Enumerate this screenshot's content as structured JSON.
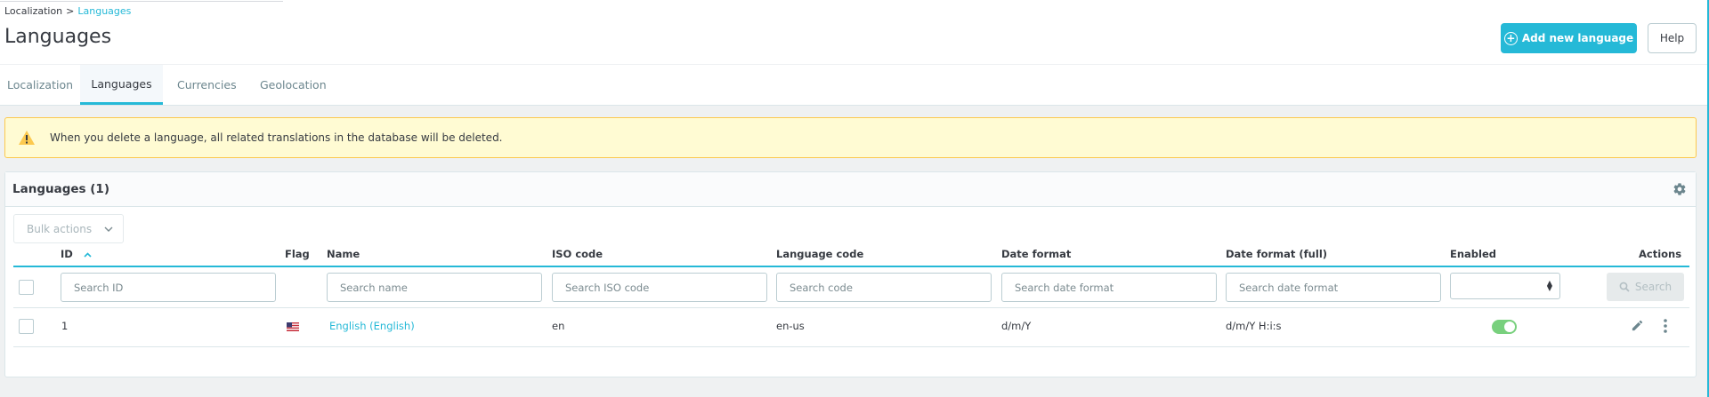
{
  "breadcrumb": {
    "parent": "Localization",
    "separator": ">",
    "current": "Languages"
  },
  "page_title": "Languages",
  "toolbar": {
    "add_label": "Add new language",
    "add_icon": "plus-circle-icon",
    "help_label": "Help"
  },
  "tabs": [
    {
      "label": "Localization",
      "active": false
    },
    {
      "label": "Languages",
      "active": true
    },
    {
      "label": "Currencies",
      "active": false
    },
    {
      "label": "Geolocation",
      "active": false
    }
  ],
  "alert": {
    "icon": "warning-icon",
    "message": "When you delete a language, all related translations in the database will be deleted."
  },
  "card": {
    "title": "Languages (1)",
    "settings_icon": "gear-icon",
    "bulk_actions": "Bulk actions",
    "columns": {
      "id": "ID",
      "flag": "Flag",
      "name": "Name",
      "iso": "ISO code",
      "lang_code": "Language code",
      "date_format": "Date format",
      "date_format_full": "Date format (full)",
      "enabled": "Enabled",
      "actions": "Actions"
    },
    "sort": {
      "column": "ID",
      "direction": "asc"
    },
    "filters": {
      "id": "Search ID",
      "name": "Search name",
      "iso": "Search ISO code",
      "lang_code": "Search code",
      "date_format": "Search date format",
      "date_format_full": "Search date format",
      "search_button": "Search"
    },
    "rows": [
      {
        "id": "1",
        "flag": "us-flag",
        "name": "English (English)",
        "iso": "en",
        "lang_code": "en-us",
        "date_format": "d/m/Y",
        "date_format_full": "d/m/Y H:i:s",
        "enabled": true
      }
    ]
  },
  "colors": {
    "accent": "#25b9d7",
    "alert_bg": "#fffbd3",
    "alert_border": "#fcc94f",
    "toggle_on": "#78d07d"
  }
}
